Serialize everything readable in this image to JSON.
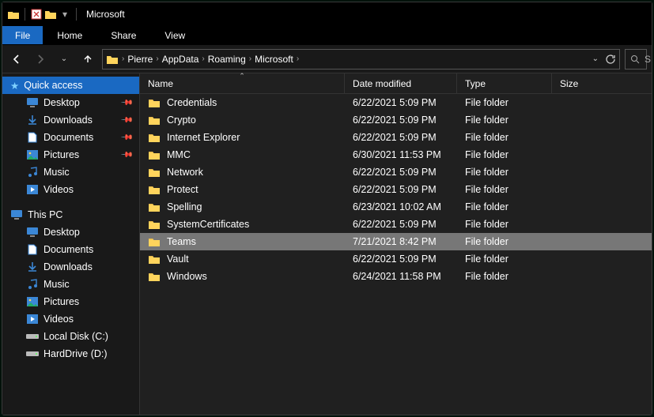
{
  "title": "Microsoft",
  "file_tab": "File",
  "ribbon_tabs": [
    "Home",
    "Share",
    "View"
  ],
  "breadcrumbs": [
    "Pierre",
    "AppData",
    "Roaming",
    "Microsoft"
  ],
  "search_label": "S",
  "nav": {
    "back": "←",
    "forward": "→",
    "recent": "⌄",
    "up": "↑",
    "dropdown": "⌄",
    "refresh": "⟳",
    "search_icon": "🔍"
  },
  "quick_access": {
    "label": "Quick access",
    "items": [
      {
        "icon": "desktop",
        "label": "Desktop",
        "pinned": true
      },
      {
        "icon": "downloads",
        "label": "Downloads",
        "pinned": true
      },
      {
        "icon": "documents",
        "label": "Documents",
        "pinned": true
      },
      {
        "icon": "pictures",
        "label": "Pictures",
        "pinned": true
      },
      {
        "icon": "music",
        "label": "Music",
        "pinned": false
      },
      {
        "icon": "videos",
        "label": "Videos",
        "pinned": false
      }
    ]
  },
  "this_pc": {
    "label": "This PC",
    "items": [
      {
        "icon": "desktop",
        "label": "Desktop"
      },
      {
        "icon": "documents",
        "label": "Documents"
      },
      {
        "icon": "downloads",
        "label": "Downloads"
      },
      {
        "icon": "music",
        "label": "Music"
      },
      {
        "icon": "pictures",
        "label": "Pictures"
      },
      {
        "icon": "videos",
        "label": "Videos"
      },
      {
        "icon": "disk",
        "label": "Local Disk (C:)"
      },
      {
        "icon": "disk",
        "label": "HardDrive (D:)"
      }
    ]
  },
  "columns": {
    "name": "Name",
    "date": "Date modified",
    "type": "Type",
    "size": "Size"
  },
  "rows": [
    {
      "name": "Credentials",
      "date": "6/22/2021 5:09 PM",
      "type": "File folder",
      "selected": false
    },
    {
      "name": "Crypto",
      "date": "6/22/2021 5:09 PM",
      "type": "File folder",
      "selected": false
    },
    {
      "name": "Internet Explorer",
      "date": "6/22/2021 5:09 PM",
      "type": "File folder",
      "selected": false
    },
    {
      "name": "MMC",
      "date": "6/30/2021 11:53 PM",
      "type": "File folder",
      "selected": false
    },
    {
      "name": "Network",
      "date": "6/22/2021 5:09 PM",
      "type": "File folder",
      "selected": false
    },
    {
      "name": "Protect",
      "date": "6/22/2021 5:09 PM",
      "type": "File folder",
      "selected": false
    },
    {
      "name": "Spelling",
      "date": "6/23/2021 10:02 AM",
      "type": "File folder",
      "selected": false
    },
    {
      "name": "SystemCertificates",
      "date": "6/22/2021 5:09 PM",
      "type": "File folder",
      "selected": false
    },
    {
      "name": "Teams",
      "date": "7/21/2021 8:42 PM",
      "type": "File folder",
      "selected": true
    },
    {
      "name": "Vault",
      "date": "6/22/2021 5:09 PM",
      "type": "File folder",
      "selected": false
    },
    {
      "name": "Windows",
      "date": "6/24/2021 11:58 PM",
      "type": "File folder",
      "selected": false
    }
  ]
}
